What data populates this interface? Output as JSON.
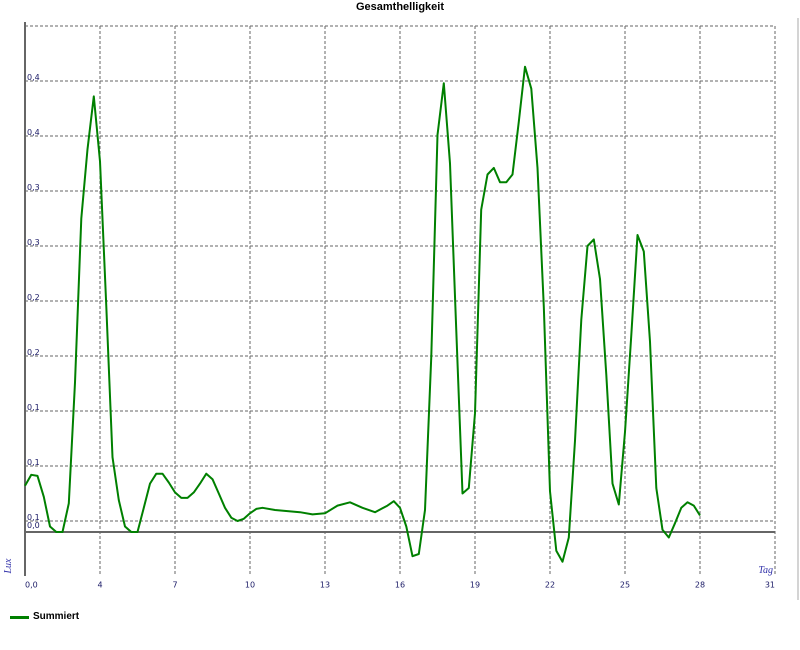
{
  "chart_data": {
    "type": "line",
    "title": "Gesamthelligkeit",
    "xlabel": "Tag",
    "ylabel": "Lux",
    "xlim": [
      1,
      31
    ],
    "ylim": [
      0,
      0.5
    ],
    "x_ticks": [
      "0,0",
      "4",
      "7",
      "10",
      "13",
      "16",
      "19",
      "22",
      "25",
      "28",
      "31"
    ],
    "y_ticks": [
      "0,0",
      "0,1",
      "0,1",
      "0,1",
      "0,2",
      "0,2",
      "0,3",
      "0,3",
      "0,4",
      "0,4"
    ],
    "grid": true,
    "legend_position": "bottom-left",
    "colors": {
      "series": "#008000",
      "grid": "#666666",
      "axis": "#666666"
    },
    "series": [
      {
        "name": "Summiert",
        "color": "#008000",
        "points": [
          [
            1.0,
            0.082
          ],
          [
            1.25,
            0.092
          ],
          [
            1.5,
            0.091
          ],
          [
            1.75,
            0.072
          ],
          [
            2.0,
            0.045
          ],
          [
            2.25,
            0.04
          ],
          [
            2.5,
            0.04
          ],
          [
            2.75,
            0.066
          ],
          [
            3.0,
            0.176
          ],
          [
            3.25,
            0.325
          ],
          [
            3.5,
            0.388
          ],
          [
            3.75,
            0.436
          ],
          [
            4.0,
            0.377
          ],
          [
            4.25,
            0.245
          ],
          [
            4.5,
            0.108
          ],
          [
            4.75,
            0.069
          ],
          [
            5.0,
            0.045
          ],
          [
            5.25,
            0.04
          ],
          [
            5.5,
            0.04
          ],
          [
            5.75,
            0.062
          ],
          [
            6.0,
            0.084
          ],
          [
            6.25,
            0.093
          ],
          [
            6.5,
            0.093
          ],
          [
            6.75,
            0.085
          ],
          [
            7.0,
            0.076
          ],
          [
            7.25,
            0.071
          ],
          [
            7.5,
            0.071
          ],
          [
            7.75,
            0.076
          ],
          [
            8.0,
            0.084
          ],
          [
            8.25,
            0.093
          ],
          [
            8.5,
            0.088
          ],
          [
            8.75,
            0.075
          ],
          [
            9.0,
            0.062
          ],
          [
            9.25,
            0.053
          ],
          [
            9.5,
            0.05
          ],
          [
            9.75,
            0.052
          ],
          [
            10.0,
            0.057
          ],
          [
            10.25,
            0.061
          ],
          [
            10.5,
            0.062
          ],
          [
            11.0,
            0.06
          ],
          [
            12.0,
            0.058
          ],
          [
            12.5,
            0.056
          ],
          [
            13.0,
            0.057
          ],
          [
            13.5,
            0.064
          ],
          [
            14.0,
            0.067
          ],
          [
            14.5,
            0.062
          ],
          [
            15.0,
            0.058
          ],
          [
            15.5,
            0.064
          ],
          [
            15.75,
            0.068
          ],
          [
            16.0,
            0.062
          ],
          [
            16.25,
            0.045
          ],
          [
            16.5,
            0.018
          ],
          [
            16.75,
            0.02
          ],
          [
            17.0,
            0.06
          ],
          [
            17.25,
            0.2
          ],
          [
            17.5,
            0.401
          ],
          [
            17.75,
            0.448
          ],
          [
            18.0,
            0.375
          ],
          [
            18.25,
            0.225
          ],
          [
            18.5,
            0.075
          ],
          [
            18.75,
            0.08
          ],
          [
            19.0,
            0.148
          ],
          [
            19.25,
            0.333
          ],
          [
            19.5,
            0.365
          ],
          [
            19.75,
            0.371
          ],
          [
            20.0,
            0.358
          ],
          [
            20.25,
            0.358
          ],
          [
            20.5,
            0.365
          ],
          [
            20.75,
            0.413
          ],
          [
            21.0,
            0.463
          ],
          [
            21.25,
            0.443
          ],
          [
            21.5,
            0.371
          ],
          [
            21.75,
            0.245
          ],
          [
            22.0,
            0.077
          ],
          [
            22.25,
            0.023
          ],
          [
            22.5,
            0.013
          ],
          [
            22.75,
            0.035
          ],
          [
            23.0,
            0.123
          ],
          [
            23.25,
            0.233
          ],
          [
            23.5,
            0.3
          ],
          [
            23.75,
            0.306
          ],
          [
            24.0,
            0.27
          ],
          [
            24.25,
            0.183
          ],
          [
            24.5,
            0.084
          ],
          [
            24.75,
            0.065
          ],
          [
            25.0,
            0.131
          ],
          [
            25.25,
            0.219
          ],
          [
            25.5,
            0.31
          ],
          [
            25.75,
            0.295
          ],
          [
            26.0,
            0.213
          ],
          [
            26.25,
            0.08
          ],
          [
            26.5,
            0.042
          ],
          [
            26.75,
            0.035
          ],
          [
            27.0,
            0.048
          ],
          [
            27.25,
            0.062
          ],
          [
            27.5,
            0.067
          ],
          [
            27.75,
            0.064
          ],
          [
            28.0,
            0.055
          ]
        ]
      }
    ]
  }
}
